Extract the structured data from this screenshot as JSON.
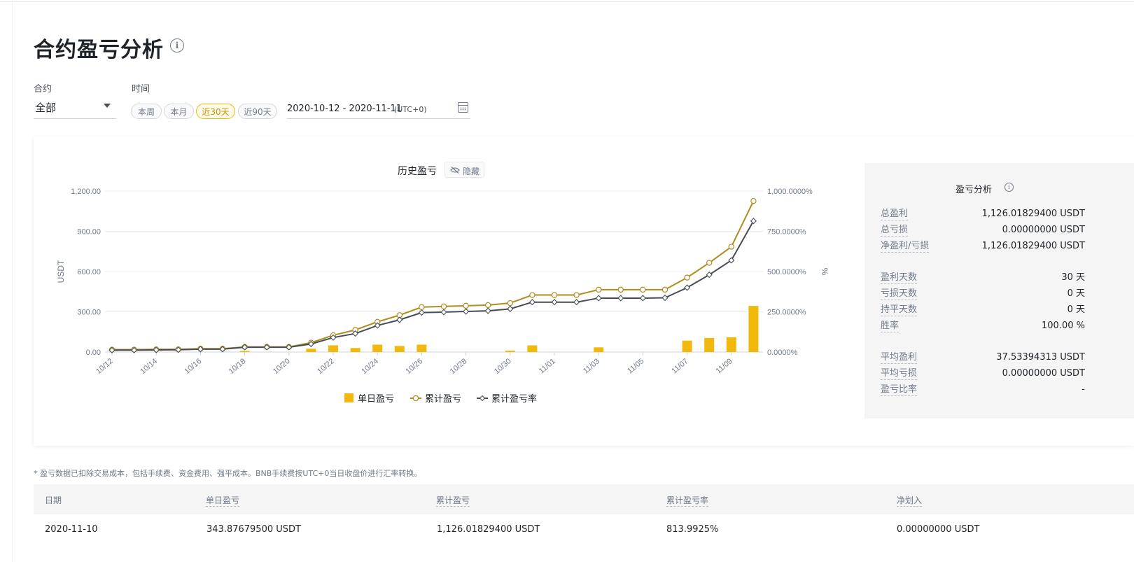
{
  "page": {
    "title": "合约盈亏分析",
    "info_icon": "info-icon",
    "info_glyph": "i"
  },
  "filters": {
    "contract_label": "合约",
    "contract_value": "全部",
    "time_label": "时间",
    "chips": [
      "本周",
      "本月",
      "近30天",
      "近90天"
    ],
    "active_chip": "近30天",
    "date_range": "2020-10-12 - 2020-11-11",
    "timezone": "(UTC+0)",
    "calendar_icon": "calendar-icon"
  },
  "chart_section": {
    "title": "历史盈亏",
    "hide_label": "隐藏",
    "hide_icon": "eye-slash-icon"
  },
  "chart_data": {
    "type": "bar",
    "x_ticks": [
      "10/12",
      "10/14",
      "10/16",
      "10/18",
      "10/20",
      "10/22",
      "10/24",
      "10/26",
      "10/28",
      "10/30",
      "11/01",
      "11/03",
      "11/05",
      "11/07",
      "11/09"
    ],
    "x": [
      "10/12",
      "10/13",
      "10/14",
      "10/15",
      "10/16",
      "10/17",
      "10/18",
      "10/19",
      "10/20",
      "10/21",
      "10/22",
      "10/23",
      "10/24",
      "10/25",
      "10/26",
      "10/27",
      "10/28",
      "10/29",
      "10/30",
      "10/31",
      "11/01",
      "11/02",
      "11/03",
      "11/04",
      "11/05",
      "11/06",
      "11/07",
      "11/08",
      "11/09",
      "11/10"
    ],
    "ylabel": "USDT",
    "ylabel_right": "%",
    "y_ticks": [
      "0.00",
      "300.00",
      "600.00",
      "900.00",
      "1,200.00"
    ],
    "y_ticks_right": [
      "0.0000%",
      "250.0000%",
      "500.0000%",
      "750.0000%",
      "1,000.0000%"
    ],
    "ylim": [
      0,
      1200
    ],
    "ylim_right": [
      0,
      1000
    ],
    "grid": true,
    "legend_position": "bottom",
    "colors": {
      "bar": "#f0b90b",
      "cumulative": "#b08c1c",
      "rate": "#474d57"
    },
    "series": [
      {
        "name": "单日盈亏",
        "type": "bar",
        "axis": "left",
        "values": [
          0,
          0,
          0,
          0,
          0,
          0,
          8,
          0,
          0,
          25,
          50,
          30,
          55,
          45,
          55,
          0,
          0,
          0,
          10,
          50,
          0,
          0,
          35,
          0,
          0,
          0,
          85,
          105,
          110,
          344
        ]
      },
      {
        "name": "累计盈亏",
        "type": "line",
        "axis": "left",
        "values": [
          18,
          18,
          20,
          20,
          25,
          25,
          38,
          38,
          38,
          70,
          125,
          165,
          225,
          275,
          335,
          340,
          345,
          350,
          365,
          425,
          425,
          425,
          465,
          465,
          465,
          465,
          555,
          665,
          785,
          1126
        ]
      },
      {
        "name": "累计盈亏率",
        "type": "line",
        "axis": "right",
        "values": [
          12,
          12,
          13,
          14,
          18,
          18,
          30,
          30,
          30,
          50,
          90,
          115,
          165,
          200,
          245,
          248,
          252,
          256,
          268,
          310,
          310,
          310,
          335,
          335,
          335,
          337,
          400,
          480,
          570,
          813.99
        ]
      }
    ]
  },
  "stats": {
    "title": "盈亏分析",
    "info_glyph": "i",
    "rows": [
      {
        "label": "总盈利",
        "value": "1,126.01829400 USDT"
      },
      {
        "label": "总亏损",
        "value": "0.00000000 USDT"
      },
      {
        "label": "净盈利/亏损",
        "value": "1,126.01829400 USDT"
      },
      {
        "label": "盈利天数",
        "value": "30 天"
      },
      {
        "label": "亏损天数",
        "value": "0 天"
      },
      {
        "label": "持平天数",
        "value": "0 天"
      },
      {
        "label": "胜率",
        "value": "100.00 %"
      },
      {
        "label": "平均盈利",
        "value": "37.53394313 USDT"
      },
      {
        "label": "平均亏损",
        "value": "0.00000000 USDT"
      },
      {
        "label": "盈亏比率",
        "value": "-"
      }
    ]
  },
  "footnote": "* 盈亏数据已扣除交易成本，包括手续费、资金费用、强平成本。BNB手续费按UTC+0当日收盘价进行汇率转换。",
  "table": {
    "headers": [
      "日期",
      "单日盈亏",
      "累计盈亏",
      "累计盈亏率",
      "净划入"
    ],
    "rows": [
      [
        "2020-11-10",
        "343.87679500 USDT",
        "1,126.01829400 USDT",
        "813.9925%",
        "0.00000000 USDT"
      ]
    ]
  }
}
